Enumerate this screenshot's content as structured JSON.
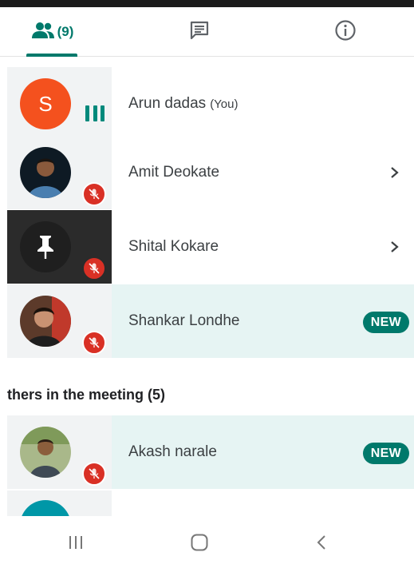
{
  "tabs": {
    "people_count": "(9)",
    "active": "people"
  },
  "participants": [
    {
      "name": "Arun dadas",
      "suffix": "(You)",
      "avatar_letter": "S",
      "avatar_color": "#f4511e",
      "status": "speaking"
    },
    {
      "name": "Amit Deokate",
      "status": "muted",
      "avatar": "photo"
    },
    {
      "name": "Shital Kokare",
      "status": "muted",
      "avatar": "pin-icon"
    },
    {
      "name": "Shankar Londhe",
      "status": "muted",
      "avatar": "photo",
      "badge": "NEW"
    }
  ],
  "others_section": {
    "title": "thers in the meeting (5)",
    "items": [
      {
        "name": "Akash narale",
        "status": "muted",
        "avatar": "photo",
        "badge": "NEW"
      }
    ]
  },
  "colors": {
    "accent": "#00796b",
    "mute_red": "#d93025",
    "highlight_row": "#e6f4f3"
  }
}
